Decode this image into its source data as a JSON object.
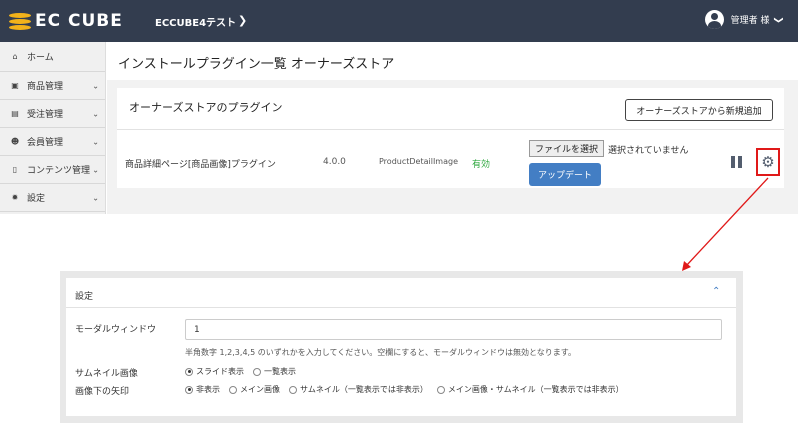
{
  "header": {
    "logo_text": "EC CUBE",
    "shop_name": "ECCUBE4テスト",
    "shop_chevron": "❯",
    "user_name": "管理者 様",
    "user_chevron": "❯"
  },
  "sidebar": {
    "items": [
      {
        "icon": "⌂",
        "label": "ホーム",
        "chevron": ""
      },
      {
        "icon": "▣",
        "label": "商品管理",
        "chevron": "⌄"
      },
      {
        "icon": "▤",
        "label": "受注管理",
        "chevron": "⌄"
      },
      {
        "icon": "☻",
        "label": "会員管理",
        "chevron": "⌄"
      },
      {
        "icon": "▯",
        "label": "コンテンツ管理",
        "chevron": "⌄"
      },
      {
        "icon": "✹",
        "label": "設定",
        "chevron": "⌄"
      }
    ]
  },
  "page": {
    "title": "インストールプラグイン一覧 オーナーズストア"
  },
  "store_card": {
    "title": "オーナーズストアのプラグイン",
    "add_button": "オーナーズストアから新規追加"
  },
  "plugin": {
    "name": "商品詳細ページ[商品画像]プラグイン",
    "version": "4.0.0",
    "code": "ProductDetailImage",
    "status": "有効",
    "file_button": "ファイルを選択",
    "file_status": "選択されていません",
    "update_button": "アップデート"
  },
  "settings": {
    "title": "設定",
    "collapse_icon": "⌃",
    "modal_label": "モーダルウィンドウ",
    "modal_value": "1",
    "modal_help": "半角数字 1,2,3,4,5 のいずれかを入力してください。空欄にすると、モーダルウィンドウは無効となります。",
    "thumb_label": "サムネイル画像",
    "thumb_options": [
      {
        "label": "スライド表示",
        "selected": true
      },
      {
        "label": "一覧表示",
        "selected": false
      }
    ],
    "arrow_label": "画像下の矢印",
    "arrow_options": [
      {
        "label": "非表示",
        "selected": true
      },
      {
        "label": "メイン画像",
        "selected": false
      },
      {
        "label": "サムネイル（一覧表示では非表示）",
        "selected": false
      },
      {
        "label": "メイン画像・サムネイル（一覧表示では非表示）",
        "selected": false
      }
    ]
  },
  "colors": {
    "header_bg": "#333d4f",
    "primary": "#437ec4",
    "status_green": "#2fa83f",
    "highlight_red": "#e01919",
    "logo_gold": "#f2b21b"
  }
}
